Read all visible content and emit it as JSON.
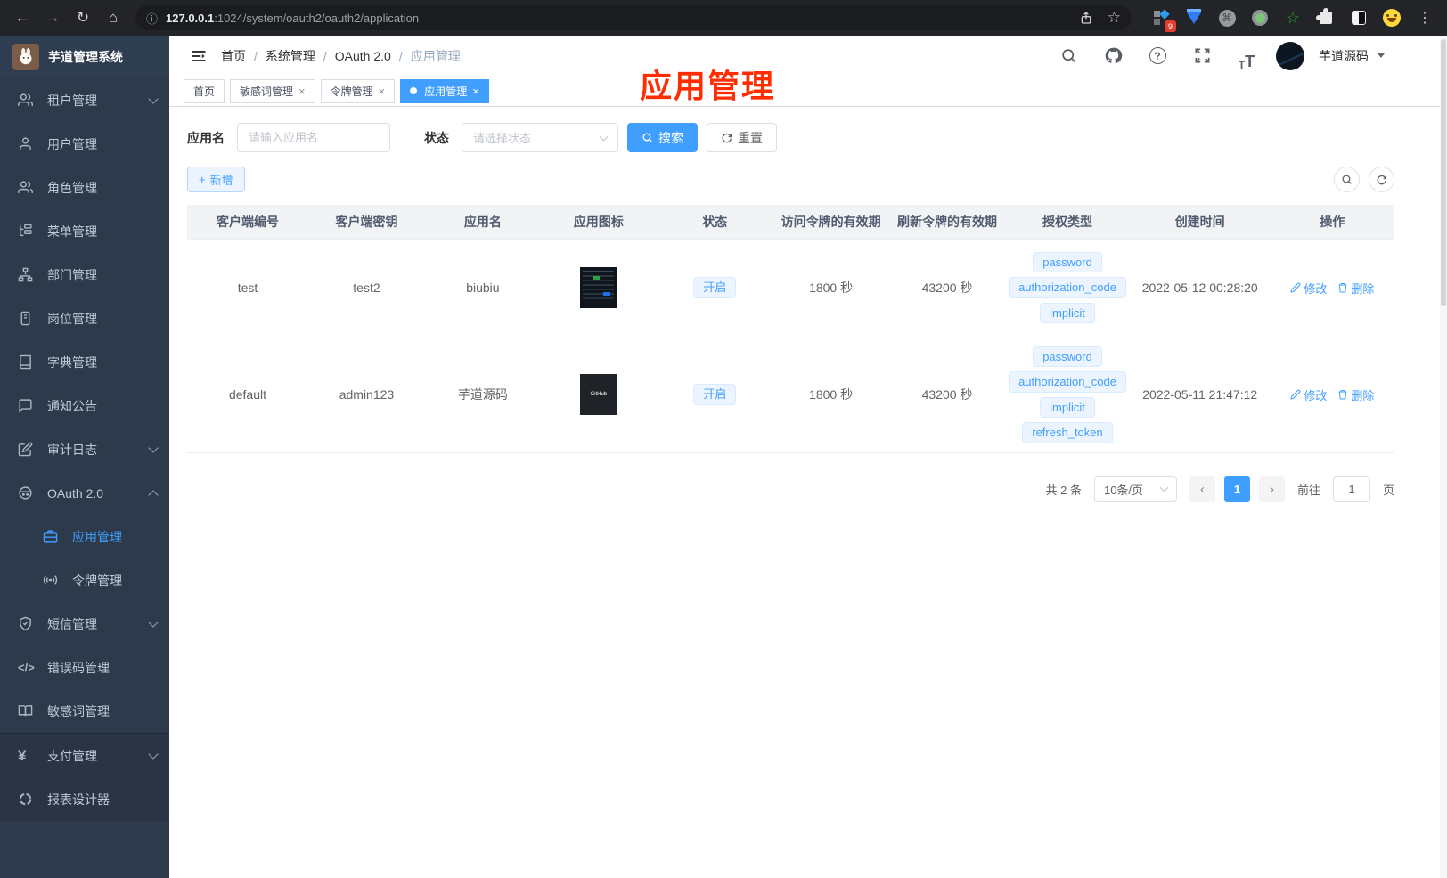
{
  "ui": {
    "glyphs": {
      "close": "×",
      "back": "←",
      "forward": "→",
      "reload": "↻",
      "home": "⌂",
      "info": "ⓘ",
      "star": "☆",
      "dots": "⋮",
      "sep": "/",
      "plus": "+",
      "prev": "‹",
      "next": "›",
      "cmd": "⌘",
      "question": "?",
      "code": "</>",
      "yen": "¥",
      "letter_t": "T"
    }
  },
  "browser": {
    "url_host": "127.0.0.1",
    "url_rest": ":1024/system/oauth2/oauth2/application",
    "extension_badge": "9"
  },
  "sidebar": {
    "title": "芋道管理系统",
    "items": [
      {
        "label": "租户管理"
      },
      {
        "label": "用户管理"
      },
      {
        "label": "角色管理"
      },
      {
        "label": "菜单管理"
      },
      {
        "label": "部门管理"
      },
      {
        "label": "岗位管理"
      },
      {
        "label": "字典管理"
      },
      {
        "label": "通知公告"
      },
      {
        "label": "审计日志"
      },
      {
        "label": "OAuth 2.0"
      },
      {
        "label": "应用管理"
      },
      {
        "label": "令牌管理"
      },
      {
        "label": "短信管理"
      },
      {
        "label": "错误码管理"
      },
      {
        "label": "敏感词管理"
      },
      {
        "label": "支付管理"
      },
      {
        "label": "报表设计器"
      }
    ]
  },
  "header": {
    "breadcrumb": [
      "首页",
      "系统管理",
      "OAuth 2.0",
      "应用管理"
    ],
    "username": "芋道源码"
  },
  "tabs": [
    {
      "label": "首页"
    },
    {
      "label": "敏感词管理"
    },
    {
      "label": "令牌管理"
    },
    {
      "label": "应用管理"
    }
  ],
  "annotation": {
    "text": "应用管理",
    "color": "#ff2d00"
  },
  "filters": {
    "name_label": "应用名",
    "name_placeholder": "请输入应用名",
    "status_label": "状态",
    "status_placeholder": "请选择状态",
    "search_label": "搜索",
    "reset_label": "重置"
  },
  "toolbar": {
    "add_label": "新增"
  },
  "table": {
    "columns": [
      "客户端编号",
      "客户端密钥",
      "应用名",
      "应用图标",
      "状态",
      "访问令牌的有效期",
      "刷新令牌的有效期",
      "授权类型",
      "创建时间",
      "操作"
    ],
    "edit_label": "修改",
    "delete_label": "删除",
    "rows": [
      {
        "client_id": "test",
        "client_secret": "test2",
        "name": "biubiu",
        "status": "开启",
        "access_token_ttl": "1800 秒",
        "refresh_token_ttl": "43200 秒",
        "grants": [
          "password",
          "authorization_code",
          "implicit"
        ],
        "created_at": "2022-05-12 00:28:20"
      },
      {
        "client_id": "default",
        "client_secret": "admin123",
        "name": "芋道源码",
        "icon_text": "GitHub",
        "status": "开启",
        "access_token_ttl": "1800 秒",
        "refresh_token_ttl": "43200 秒",
        "grants": [
          "password",
          "authorization_code",
          "implicit",
          "refresh_token"
        ],
        "created_at": "2022-05-11 21:47:12"
      }
    ]
  },
  "pagination": {
    "total_text": "共 2 条",
    "page_size": "10条/页",
    "current_page": "1",
    "goto_prefix": "前往",
    "goto_value": "1",
    "goto_suffix": "页"
  },
  "colors": {
    "accent": "#409eff",
    "sidebar_bg": "#2d3a4b",
    "annotation_red": "#ff2d00"
  }
}
